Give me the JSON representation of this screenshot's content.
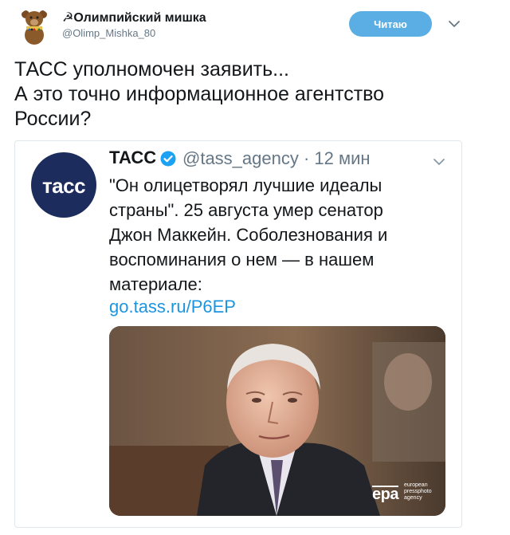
{
  "header": {
    "display_name": "Олимпийский мишка",
    "name_prefix": "☭",
    "handle": "@Olimp_Mishka_80",
    "follow_label": "Читаю"
  },
  "tweet": {
    "text_lines": [
      "ТАСС уполномочен заявить...",
      "А это точно информационное агентство",
      "России?"
    ]
  },
  "quoted": {
    "logo_text": "тасс",
    "name": "ТАСС",
    "handle_time": "@tass_agency · 12 мин",
    "text_lines": [
      "\"Он олицетворял лучшие идеалы",
      "страны\". 25 августа умер сенатор",
      "Джон Маккейн. Соболезнования и",
      "воспоминания о нем — в нашем",
      "материале:"
    ],
    "link": "go.tass.ru/P6EP",
    "photo": {
      "credit_logo": "epa",
      "credit_lines": [
        "european",
        "pressphoto",
        "agency"
      ]
    }
  },
  "colors": {
    "follow_button": "#5aaee3",
    "link": "#1b95e0",
    "tass_blue": "#1c2d5d",
    "verified": "#1da1f2",
    "secondary_text": "#657786"
  }
}
